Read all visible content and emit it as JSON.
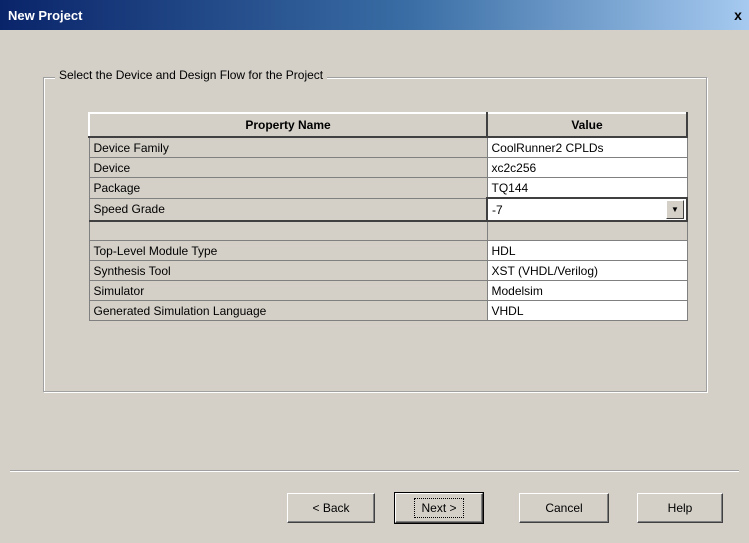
{
  "window": {
    "title": "New Project",
    "close_label": "x"
  },
  "group": {
    "label": "Select the Device and Design Flow for the Project"
  },
  "table": {
    "headers": {
      "name": "Property Name",
      "value": "Value"
    },
    "device_rows": [
      {
        "name": "Device Family",
        "value": "CoolRunner2 CPLDs"
      },
      {
        "name": "Device",
        "value": "xc2c256"
      },
      {
        "name": "Package",
        "value": "TQ144"
      }
    ],
    "speed_grade": {
      "name": "Speed Grade",
      "value": "-7"
    },
    "flow_rows": [
      {
        "name": "Top-Level Module Type",
        "value": "HDL"
      },
      {
        "name": "Synthesis Tool",
        "value": "XST (VHDL/Verilog)"
      },
      {
        "name": "Simulator",
        "value": "Modelsim"
      },
      {
        "name": "Generated Simulation Language",
        "value": "VHDL"
      }
    ]
  },
  "buttons": {
    "back": "< Back",
    "next": "Next >",
    "cancel": "Cancel",
    "help": "Help"
  }
}
